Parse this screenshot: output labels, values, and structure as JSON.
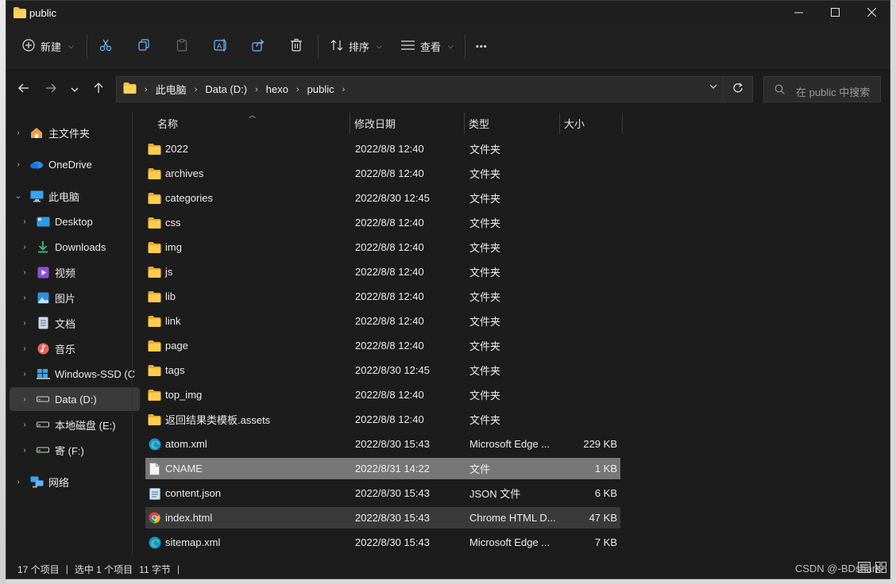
{
  "window": {
    "title": "public"
  },
  "toolbar": {
    "new_label": "新建",
    "sort_label": "排序",
    "view_label": "查看",
    "more_label": "•••"
  },
  "address": {
    "crumbs": [
      "此电脑",
      "Data (D:)",
      "hexo",
      "public"
    ]
  },
  "search": {
    "placeholder": "在 public 中搜索"
  },
  "nav": {
    "items": [
      {
        "label": "主文件夹",
        "icon": "home-icon"
      },
      {
        "label": "OneDrive",
        "icon": "cloud-icon"
      },
      {
        "label": "此电脑",
        "icon": "pc-icon"
      },
      {
        "label": "Desktop",
        "icon": "desktop-icon"
      },
      {
        "label": "Downloads",
        "icon": "download-icon"
      },
      {
        "label": "视频",
        "icon": "video-icon"
      },
      {
        "label": "图片",
        "icon": "picture-icon"
      },
      {
        "label": "文档",
        "icon": "document-icon"
      },
      {
        "label": "音乐",
        "icon": "music-icon"
      },
      {
        "label": "Windows-SSD (C",
        "icon": "drive-icon"
      },
      {
        "label": "Data (D:)",
        "icon": "drive-icon"
      },
      {
        "label": "本地磁盘 (E:)",
        "icon": "drive-icon"
      },
      {
        "label": "寄 (F:)",
        "icon": "drive-icon"
      },
      {
        "label": "网络",
        "icon": "network-icon"
      }
    ]
  },
  "columns": {
    "name": "名称",
    "date": "修改日期",
    "type": "类型",
    "size": "大小"
  },
  "files": [
    {
      "name": "2022",
      "date": "2022/8/8 12:40",
      "type": "文件夹",
      "size": "",
      "icon": "folder-icon"
    },
    {
      "name": "archives",
      "date": "2022/8/8 12:40",
      "type": "文件夹",
      "size": "",
      "icon": "folder-icon"
    },
    {
      "name": "categories",
      "date": "2022/8/30 12:45",
      "type": "文件夹",
      "size": "",
      "icon": "folder-icon"
    },
    {
      "name": "css",
      "date": "2022/8/8 12:40",
      "type": "文件夹",
      "size": "",
      "icon": "folder-icon"
    },
    {
      "name": "img",
      "date": "2022/8/8 12:40",
      "type": "文件夹",
      "size": "",
      "icon": "folder-icon"
    },
    {
      "name": "js",
      "date": "2022/8/8 12:40",
      "type": "文件夹",
      "size": "",
      "icon": "folder-icon"
    },
    {
      "name": "lib",
      "date": "2022/8/8 12:40",
      "type": "文件夹",
      "size": "",
      "icon": "folder-icon"
    },
    {
      "name": "link",
      "date": "2022/8/8 12:40",
      "type": "文件夹",
      "size": "",
      "icon": "folder-icon"
    },
    {
      "name": "page",
      "date": "2022/8/8 12:40",
      "type": "文件夹",
      "size": "",
      "icon": "folder-icon"
    },
    {
      "name": "tags",
      "date": "2022/8/30 12:45",
      "type": "文件夹",
      "size": "",
      "icon": "folder-icon"
    },
    {
      "name": "top_img",
      "date": "2022/8/8 12:40",
      "type": "文件夹",
      "size": "",
      "icon": "folder-icon"
    },
    {
      "name": "返回结果类模板.assets",
      "date": "2022/8/8 12:40",
      "type": "文件夹",
      "size": "",
      "icon": "folder-icon"
    },
    {
      "name": "atom.xml",
      "date": "2022/8/30 15:43",
      "type": "Microsoft Edge ...",
      "size": "229 KB",
      "icon": "edge-icon"
    },
    {
      "name": "CNAME",
      "date": "2022/8/31 14:22",
      "type": "文件",
      "size": "1 KB",
      "icon": "file-icon"
    },
    {
      "name": "content.json",
      "date": "2022/8/30 15:43",
      "type": "JSON 文件",
      "size": "6 KB",
      "icon": "json-icon"
    },
    {
      "name": "index.html",
      "date": "2022/8/30 15:43",
      "type": "Chrome HTML D...",
      "size": "47 KB",
      "icon": "chrome-icon"
    },
    {
      "name": "sitemap.xml",
      "date": "2022/8/30 15:43",
      "type": "Microsoft Edge ...",
      "size": "7 KB",
      "icon": "edge-icon"
    }
  ],
  "status": {
    "count": "17 个项目",
    "selection": "选中 1 个项目",
    "size": "11 字节"
  },
  "watermark": "CSDN @-BDshark-",
  "colors": {
    "window_bg": "#1c1c1c",
    "selected_row": "#777777",
    "hover_row": "#3a3a3a",
    "folder": "#f5c242",
    "accent_blue": "#4cc2ff"
  }
}
